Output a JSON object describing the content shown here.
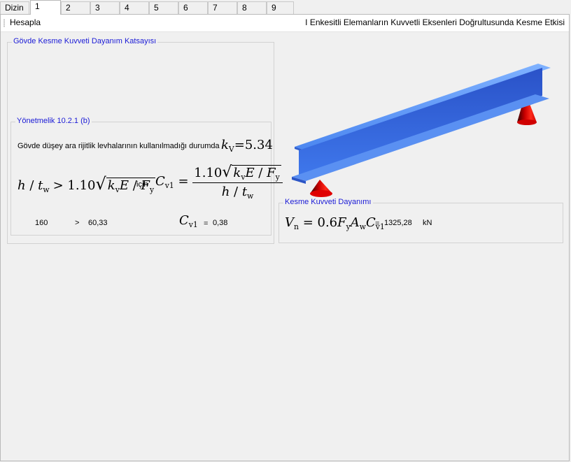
{
  "tabs": [
    "Dizin",
    "1",
    "2",
    "3",
    "4",
    "5",
    "6",
    "7",
    "8",
    "9"
  ],
  "active_tab": "1",
  "toolbar": {
    "hesapla": "Hesapla",
    "title": "I Enkesitli Elemanların Kuvvetli Eksenleri Doğrultusunda Kesme Etkisi"
  },
  "gkkd": {
    "legend": "Gövde Kesme Kuvveti Dayanım Katsayısı",
    "yonetmelik": {
      "legend": "Yönetmelik 10.2.1 (b)",
      "description": "Gövde düşey ara rijitlik levhalarının kullanılmadığı durumda",
      "kv_value": "=5.34",
      "condition_coef": "1.10",
      "icin": "için",
      "cv1_formula_coef": "1.10",
      "h_tw": "160",
      "greater": ">",
      "limit": "60,33",
      "equals": "=",
      "cv1_value": "0,38"
    }
  },
  "kesme": {
    "legend": "Kesme Kuvveti Dayanımı",
    "formula_coef": "0.6",
    "equals": "=",
    "value": "1325,28",
    "unit": "kN"
  },
  "colors": {
    "beam": "#3a6fe0",
    "support": "#e01010",
    "legend_text": "#1a1ad6"
  }
}
